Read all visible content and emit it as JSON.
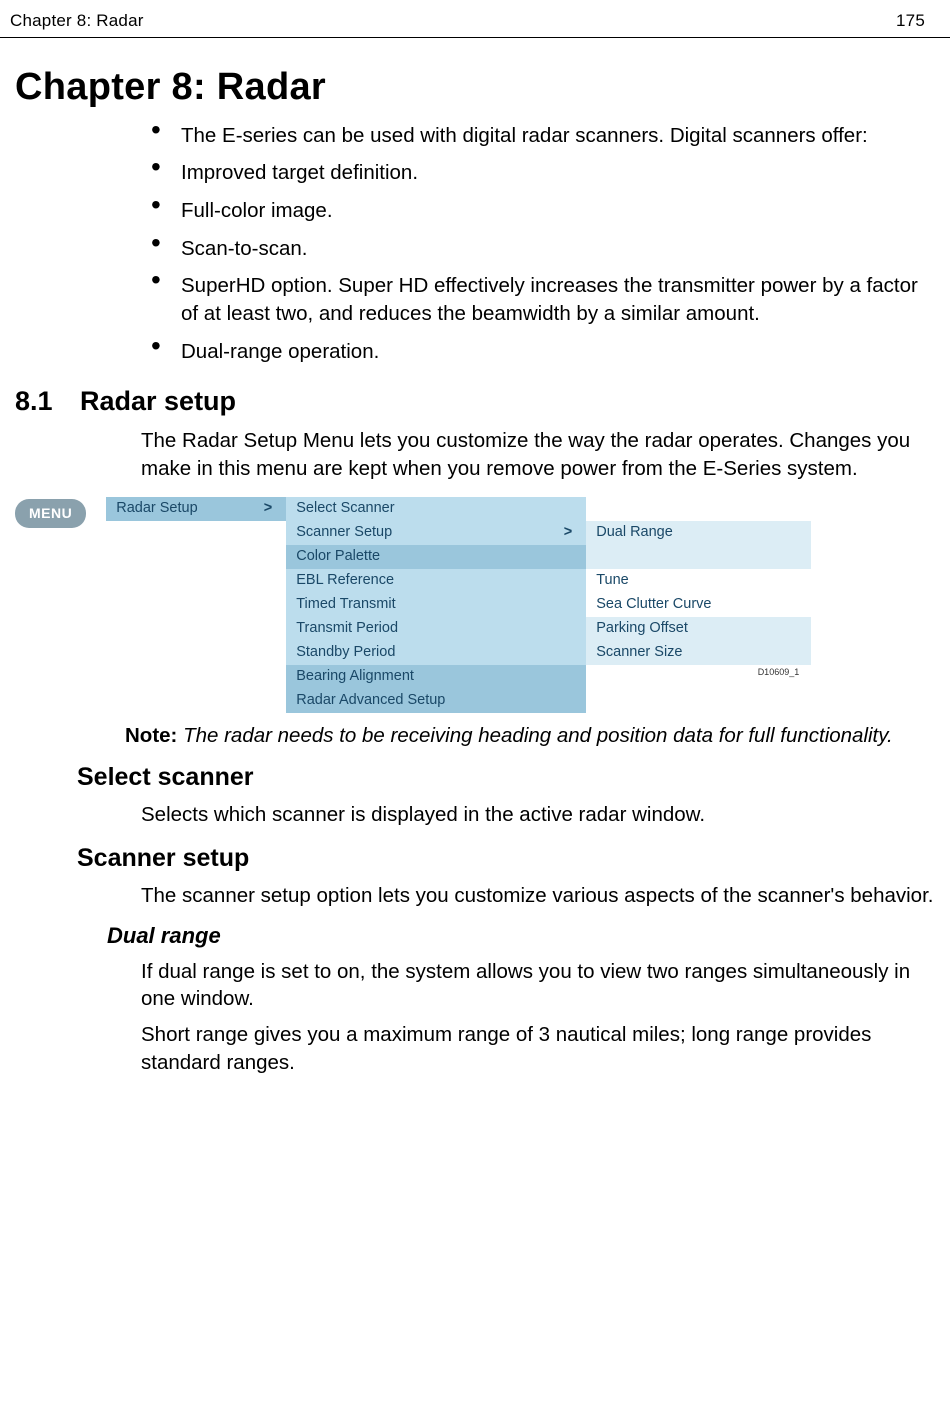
{
  "header": {
    "left": "Chapter 8: Radar",
    "right": "175"
  },
  "chapter_title": "Chapter 8:  Radar",
  "features": [
    "The E-series can be used with digital radar scanners. Digital scanners offer:",
    "Improved target definition.",
    "Full-color image.",
    "Scan-to-scan.",
    "SuperHD option. Super HD effectively increases the transmitter power by a factor of at least two, and reduces the beamwidth by a similar amount.",
    "Dual-range operation."
  ],
  "section_81": {
    "num": "8.1",
    "title": "Radar setup",
    "para": "The Radar Setup Menu lets you customize the way the radar operates. Changes you make in this menu are kept when you remove power from the E-Series system."
  },
  "menu": {
    "pill": "MENU",
    "col1": [
      {
        "label": "Radar Setup",
        "chev": ">",
        "shade": "shade-dark"
      }
    ],
    "col2": [
      {
        "label": "Select Scanner",
        "chev": "",
        "shade": "shade-mid"
      },
      {
        "label": "Scanner Setup",
        "chev": ">",
        "shade": "shade-mid"
      },
      {
        "label": "Color Palette",
        "chev": "",
        "shade": "shade-dark"
      },
      {
        "label": "EBL Reference",
        "chev": "",
        "shade": "shade-mid"
      },
      {
        "label": "Timed Transmit",
        "chev": "",
        "shade": "shade-mid"
      },
      {
        "label": "Transmit Period",
        "chev": "",
        "shade": "shade-mid"
      },
      {
        "label": "Standby Period",
        "chev": "",
        "shade": "shade-mid"
      },
      {
        "label": "Bearing Alignment",
        "chev": "",
        "shade": "shade-dark"
      },
      {
        "label": "Radar Advanced Setup",
        "chev": "",
        "shade": "shade-dark"
      }
    ],
    "col3": [
      {
        "label": "Dual Range",
        "shade": "shade-light"
      },
      {
        "label": "",
        "shade": "shade-light"
      },
      {
        "label": "Tune",
        "shade": "no-shade"
      },
      {
        "label": "Sea Clutter Curve",
        "shade": "no-shade"
      },
      {
        "label": "Parking Offset",
        "shade": "shade-light"
      },
      {
        "label": "Scanner Size",
        "shade": "shade-light"
      }
    ],
    "figref": "D10609_1"
  },
  "note": {
    "label": "Note: ",
    "body": "The radar needs to be receiving heading and position data for full functionality."
  },
  "select_scanner": {
    "title": "Select scanner",
    "para": "Selects which scanner is displayed in the active radar window."
  },
  "scanner_setup": {
    "title": "Scanner setup",
    "para": "The scanner setup option lets you customize various aspects of the scanner's behavior."
  },
  "dual_range": {
    "title": "Dual range",
    "para1": "If dual range is set to on, the system allows you to view two ranges simultaneously in one window.",
    "para2": "Short range gives you a maximum range of 3 nautical miles; long range provides standard ranges."
  }
}
